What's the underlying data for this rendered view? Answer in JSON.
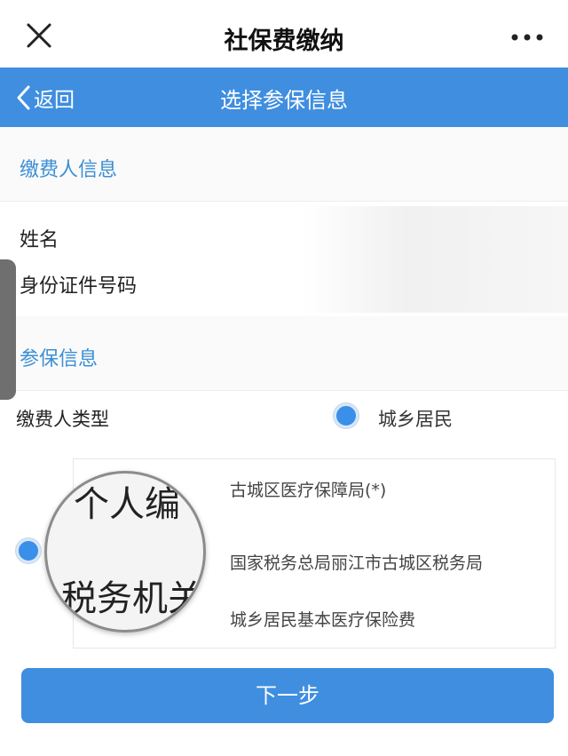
{
  "titlebar": {
    "title": "社保费缴纳",
    "close_icon": "close-icon",
    "more_icon": "more-horizontal-icon"
  },
  "navbar": {
    "back_label": "返回",
    "title": "选择参保信息",
    "color": "#3f8ee0"
  },
  "payer_section": {
    "header": "缴费人信息",
    "rows": [
      {
        "label": "姓名"
      },
      {
        "label": "身份证件号码"
      }
    ]
  },
  "insurance_section": {
    "header": "参保信息",
    "type_label": "缴费人类型",
    "type_value": "城乡居民"
  },
  "card": {
    "line1": "古城区医疗保障局(*)",
    "line2": "国家税务总局丽江市古城区税务局",
    "line3": "城乡居民基本医疗保险费",
    "magnified_line1": "个人编",
    "magnified_line2": "税务机关"
  },
  "footer": {
    "next_label": "下一步"
  }
}
